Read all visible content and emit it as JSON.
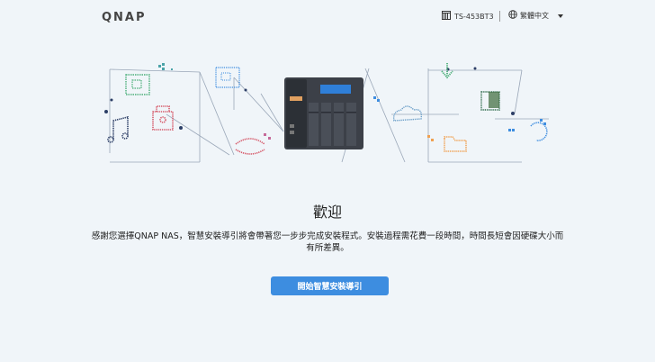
{
  "header": {
    "logo": "QNAP",
    "model": "TS-453BT3",
    "language": "繁體中文"
  },
  "main": {
    "title": "歡迎",
    "description": "感謝您選擇QNAP NAS，智慧安裝導引將會帶著您一步步完成安裝程式。安裝過程需花費一段時間，時間長短會因硬碟大小而有所差異。",
    "start_button": "開始智慧安裝導引"
  },
  "colors": {
    "background": "#f0f5f9",
    "button": "#3d8de0",
    "nas_body": "#3c4048",
    "nas_screen": "#2f7fd8"
  }
}
